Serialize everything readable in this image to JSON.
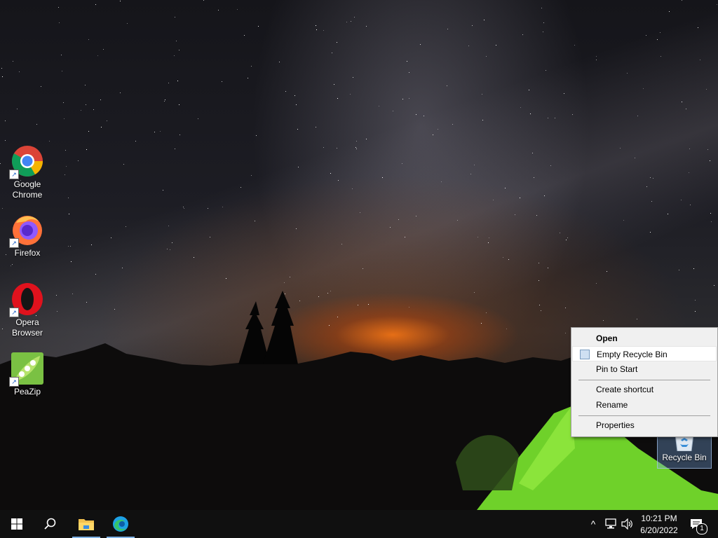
{
  "desktop": {
    "icons": [
      {
        "label_line1": "Google",
        "label_line2": "Chrome",
        "icon": "chrome-icon"
      },
      {
        "label_line1": "Firefox",
        "label_line2": "",
        "icon": "firefox-icon"
      },
      {
        "label_line1": "Opera",
        "label_line2": "Browser",
        "icon": "opera-icon"
      },
      {
        "label_line1": "PeaZip",
        "label_line2": "",
        "icon": "peazip-icon"
      }
    ],
    "recycle_bin": {
      "label": "Recycle Bin",
      "icon": "recycle-bin-icon"
    }
  },
  "context_menu": {
    "items": [
      {
        "label": "Open"
      },
      {
        "label": "Empty Recycle Bin"
      },
      {
        "label": "Pin to Start"
      },
      {
        "label": "Create shortcut"
      },
      {
        "label": "Rename"
      },
      {
        "label": "Properties"
      }
    ]
  },
  "taskbar": {
    "start_icon": "windows-start-icon",
    "search_icon": "search-icon",
    "pinned": [
      "file-explorer-icon",
      "edge-icon"
    ],
    "tray": {
      "chevron": "^",
      "network_icon": "network-icon",
      "volume_icon": "volume-icon",
      "notification_count": "1"
    },
    "clock": {
      "time": "10:21 PM",
      "date": "6/20/2022"
    }
  },
  "colors": {
    "taskbar_bg": "#101010",
    "menu_bg": "#f0f0f0",
    "accent": "#7fb2e5"
  }
}
